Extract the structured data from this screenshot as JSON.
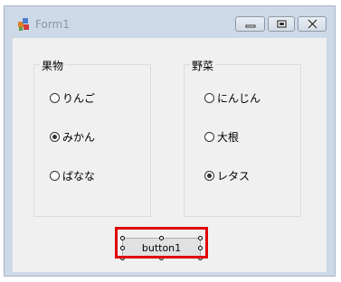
{
  "window": {
    "title": "Form1",
    "icons": {
      "app": "form-app-icon",
      "minimize": "minimize-icon",
      "maximize": "maximize-icon",
      "close": "close-icon"
    }
  },
  "fruit_group": {
    "label": "果物",
    "options": [
      {
        "label": "りんご",
        "checked": false
      },
      {
        "label": "みかん",
        "checked": true
      },
      {
        "label": "ばなな",
        "checked": false
      }
    ]
  },
  "vegetable_group": {
    "label": "野菜",
    "options": [
      {
        "label": "にんじん",
        "checked": false
      },
      {
        "label": "大根",
        "checked": false
      },
      {
        "label": "レタス",
        "checked": true
      }
    ]
  },
  "button1": {
    "label": "button1",
    "selected": true
  },
  "colors": {
    "highlight": "#e00000",
    "client_bg": "#f0f0f0",
    "frame": "#ced9e8"
  }
}
